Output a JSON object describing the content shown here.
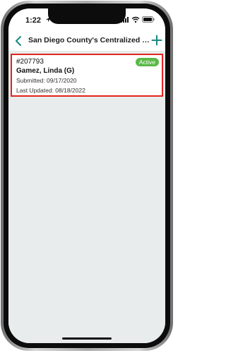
{
  "status_bar": {
    "time": "1:22",
    "icons": [
      "location-icon",
      "signal-icon",
      "wifi-icon",
      "battery-icon"
    ]
  },
  "nav": {
    "title": "San Diego County's Centralized El...",
    "back_icon": "chevron-left-icon",
    "add_icon": "plus-icon",
    "accent_color": "#1a8a85"
  },
  "applications": [
    {
      "id": "#207793",
      "name": "Gamez, Linda (G)",
      "submitted": "Submitted: 09/17/2020",
      "last_updated": "Last Updated: 08/18/2022",
      "status": "Active",
      "status_color": "#59b947",
      "highlight_color": "#e1251b"
    }
  ],
  "colors": {
    "background": "#e8ecec"
  }
}
